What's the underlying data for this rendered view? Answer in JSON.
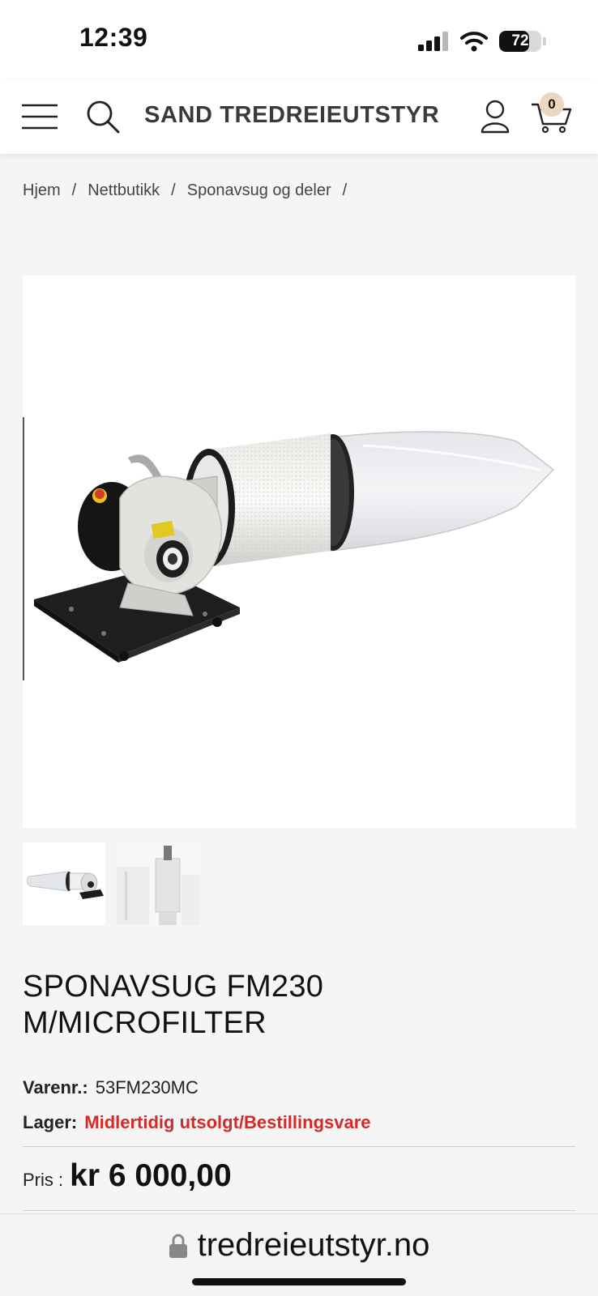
{
  "status_bar": {
    "time": "12:39",
    "battery": "72",
    "battery_level": 0.72
  },
  "header": {
    "logo": "SAND TREDREIEUTSTYR",
    "cart_count": "0",
    "icons": [
      "menu-icon",
      "search-icon",
      "account-icon",
      "cart-icon"
    ]
  },
  "breadcrumb": {
    "items": [
      "Hjem",
      "Nettbutikk",
      "Sponavsug og deler"
    ],
    "separator": "/"
  },
  "product": {
    "title": "SPONAVSUG FM230 M/MICROFILTER",
    "sku_label": "Varenr.:",
    "sku": "53FM230MC",
    "stock_label": "Lager:",
    "stock": "Midlertidig utsolgt/Bestillingsvare",
    "price_label": "Pris :",
    "price": "kr 6 000,00"
  },
  "browser": {
    "url": "tredreieutstyr.no"
  },
  "colors": {
    "accent_stock": "#d42a2a",
    "cart_badge": "#ead8c2",
    "logo_text": "#3a3a3a"
  }
}
